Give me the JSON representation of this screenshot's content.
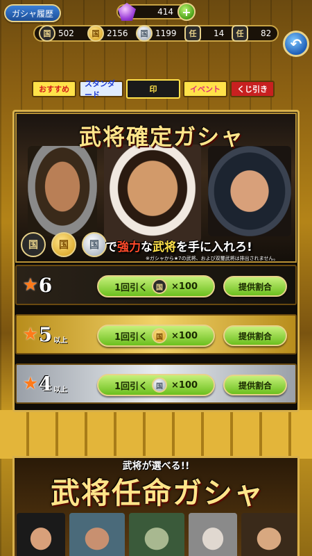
{
  "header": {
    "history_label": "ガシャ履歴",
    "gems": "414",
    "gem_icon": "crystal-icon",
    "plus_label": "+",
    "currencies": [
      {
        "icon": "black-seal-icon",
        "glyph": "国",
        "value": "502"
      },
      {
        "icon": "gold-seal-icon",
        "glyph": "国",
        "value": "2156"
      },
      {
        "icon": "silver-seal-icon",
        "glyph": "国",
        "value": "1199"
      },
      {
        "icon": "appoint-ticket-icon",
        "glyph": "任",
        "value": "14"
      },
      {
        "icon": "appoint-ticket-icon",
        "glyph": "任",
        "value": "82"
      }
    ],
    "back_icon": "back-arrow-icon"
  },
  "tabs": [
    {
      "label": "おすすめ"
    },
    {
      "label": "スタンダード"
    },
    {
      "label": "印"
    },
    {
      "label": "イベント"
    },
    {
      "label": "くじ引き"
    }
  ],
  "banner": {
    "title": "武将確定ガシャ",
    "tagline_pre": "で",
    "tagline_red": "強力",
    "tagline_mid": "な",
    "tagline_yellow": "武将",
    "tagline_post": "を手に入れろ!",
    "note": "※ガシャから★7の武将、および双璽武将は排出されません。",
    "coins": [
      "国",
      "国",
      "国"
    ]
  },
  "rows": [
    {
      "stars": "6",
      "suffix": "",
      "pull_label": "1回引く",
      "cost": "×100",
      "rate_label": "提供割合",
      "coin": "black"
    },
    {
      "stars": "5",
      "suffix": "以上",
      "pull_label": "1回引く",
      "cost": "×100",
      "rate_label": "提供割合",
      "coin": "gold"
    },
    {
      "stars": "4",
      "suffix": "以上",
      "pull_label": "1回引く",
      "cost": "×100",
      "rate_label": "提供割合",
      "coin": "silver"
    }
  ],
  "lower_banner": {
    "subtitle": "武将が選べる!!",
    "title": "武将任命ガシャ"
  }
}
